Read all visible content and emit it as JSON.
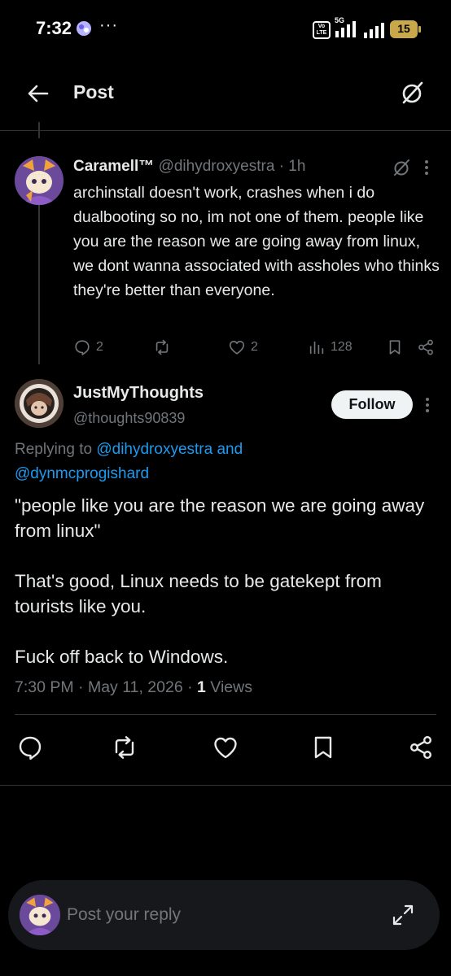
{
  "status_bar": {
    "time": "7:32",
    "dots": "···",
    "volte": "Vo LTE",
    "network": "5G",
    "battery": "15",
    "battery_color": "#c9a84a"
  },
  "header": {
    "title": "Post",
    "back_icon": "arrow-left-icon",
    "grok_icon": "grok-slash-circle-icon"
  },
  "parent_post": {
    "name": "Caramell™",
    "handle": "@dihydroxyestra",
    "separator": "·",
    "time": "1h",
    "text": "archinstall doesn't work, crashes when i do dualbooting so no, im not one of them. people like you are the reason we are going away from linux, we dont wanna associated with assholes who thinks they're better than everyone.",
    "actions": {
      "replies": "2",
      "reposts": "",
      "likes": "2",
      "views": "128"
    }
  },
  "main_post": {
    "name": "JustMyThoughts",
    "handle": "@thoughts90839",
    "follow_label": "Follow",
    "replying_prefix": "Replying to ",
    "replying_mention_1": "@dihydroxyestra",
    "replying_and": " and",
    "replying_mention_2": "@dynmcprogishard",
    "text": "\"people like you are the reason we are going away from linux\"\n\nThat's good, Linux needs to be gatekept from tourists like you.\n\nFuck off back to Windows.",
    "time": "7:30 PM",
    "sep1": " · ",
    "date": "May 11, 2026",
    "sep2": " · ",
    "views_count": "1",
    "views_label": " Views"
  },
  "composer": {
    "placeholder": "Post your reply"
  },
  "colors": {
    "background": "#000000",
    "text": "#e7e9ea",
    "muted": "#71767b",
    "link": "#1d9bf0",
    "divider": "#2f3336",
    "composer_bg": "#16181c"
  }
}
